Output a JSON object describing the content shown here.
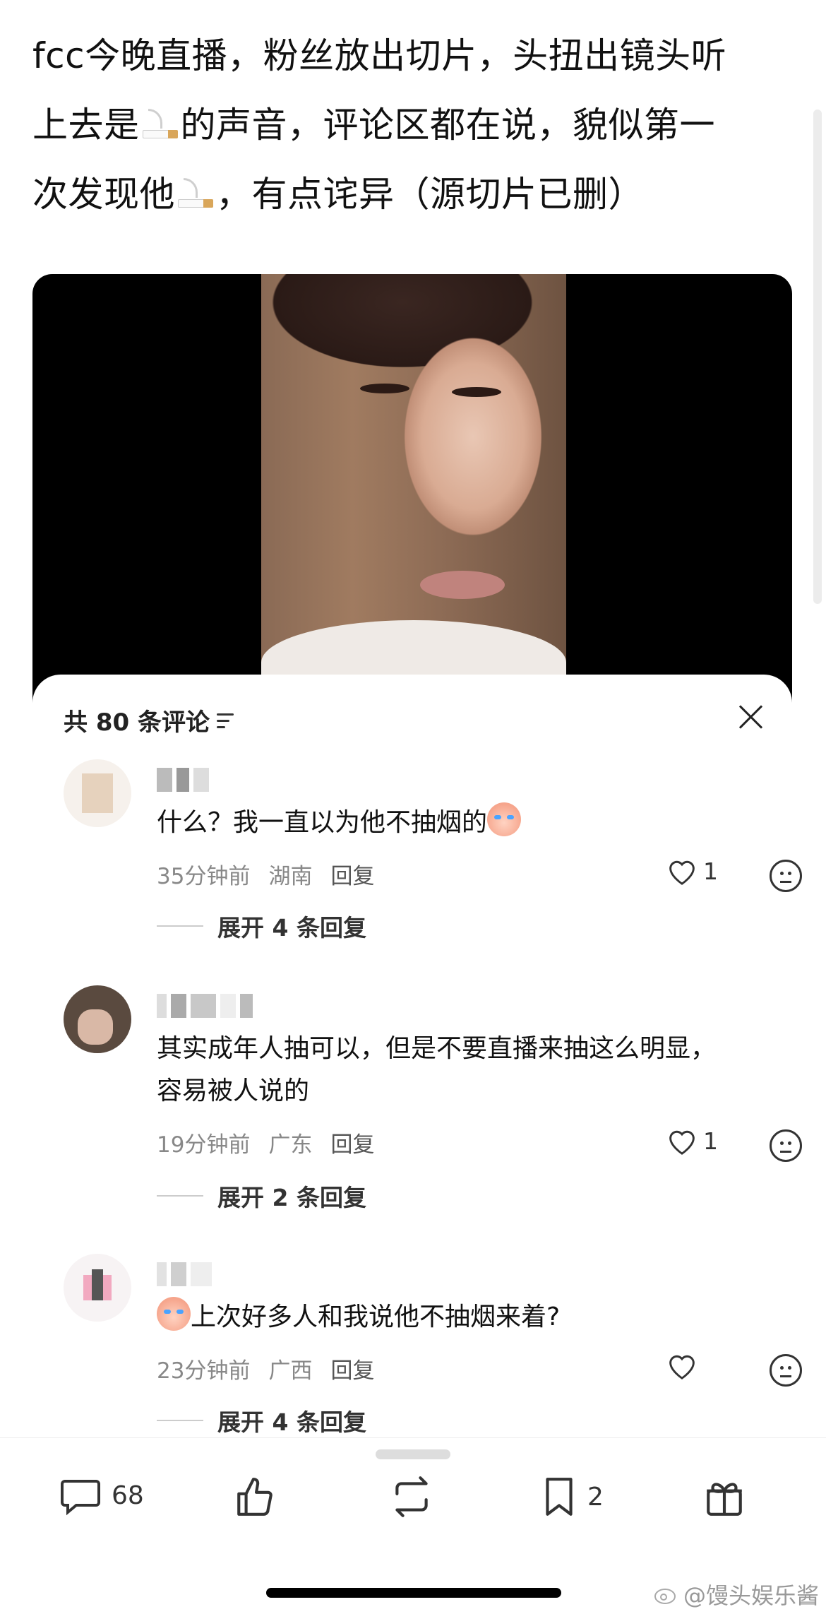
{
  "post": {
    "line1": "fcc今晚直播，粉丝放出切片，头扭出镜头听",
    "line2a": "上去是",
    "line2b": "的声音，评论区都在说，貌似第一",
    "line3a": "次发现他",
    "line3b": "，有点诧异（源切片已删）",
    "emoji": "cigarette-emoji"
  },
  "comments_sheet": {
    "header": "共 80 条评论",
    "filter_icon": "filter-icon",
    "close_icon": "close-icon"
  },
  "comments": [
    {
      "text": "什么？我一直以为他不抽烟的",
      "time": "35分钟前",
      "location": "湖南",
      "reply_label": "回复",
      "likes": "1",
      "expand": "展开 4 条回复"
    },
    {
      "text_line1": "其实成年人抽可以，但是不要直播来抽这么明显，",
      "text_line2": "容易被人说的",
      "time": "19分钟前",
      "location": "广东",
      "reply_label": "回复",
      "likes": "1",
      "expand": "展开 2 条回复"
    },
    {
      "text": "上次好多人和我说他不抽烟来着?",
      "time": "23分钟前",
      "location": "广西",
      "reply_label": "回复",
      "likes": "",
      "expand": "展开 4 条回复"
    }
  ],
  "bottom_bar": {
    "comment_count": "68",
    "bookmark_count": "2"
  },
  "watermark": "@馒头娱乐酱"
}
